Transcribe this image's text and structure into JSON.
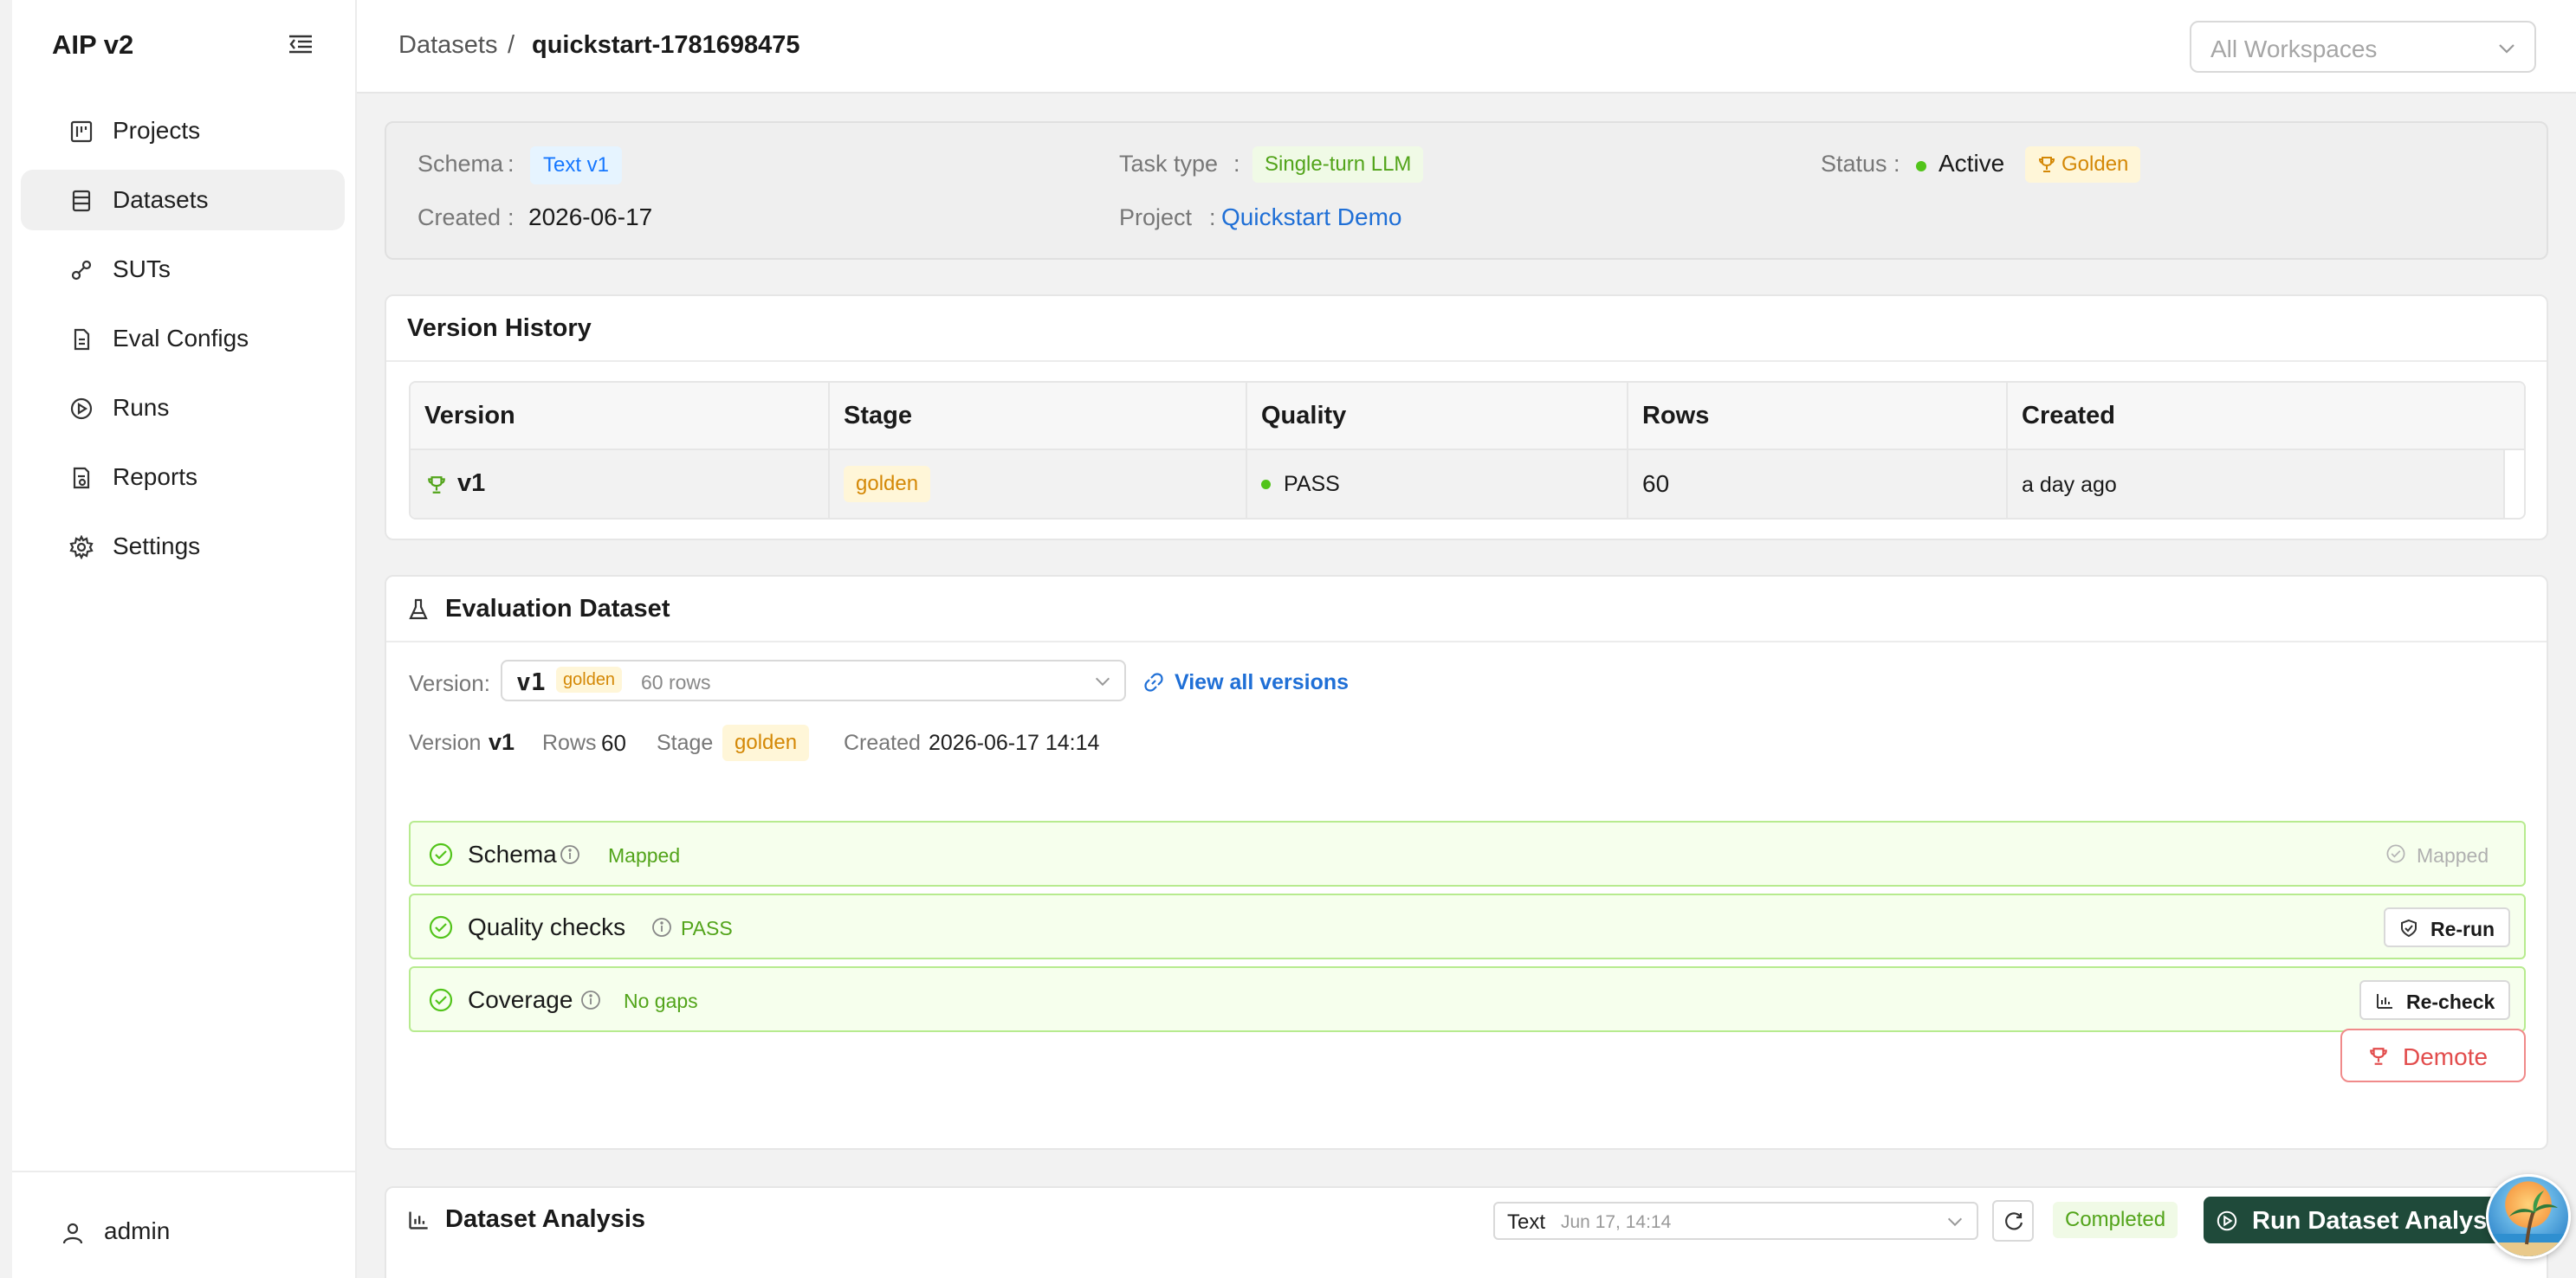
{
  "app": {
    "title": "AIP v2"
  },
  "sidebar": {
    "items": [
      {
        "label": "Projects",
        "icon": "projects-icon",
        "active": false
      },
      {
        "label": "Datasets",
        "icon": "datasets-icon",
        "active": true
      },
      {
        "label": "SUTs",
        "icon": "suts-icon",
        "active": false
      },
      {
        "label": "Eval Configs",
        "icon": "file-icon",
        "active": false
      },
      {
        "label": "Runs",
        "icon": "play-icon",
        "active": false
      },
      {
        "label": "Reports",
        "icon": "report-icon",
        "active": false
      },
      {
        "label": "Settings",
        "icon": "gear-icon",
        "active": false
      }
    ],
    "user": "admin"
  },
  "header": {
    "breadcrumb_root": "Datasets",
    "breadcrumb_sep": "/",
    "breadcrumb_current": "quickstart-1781698475",
    "workspace_placeholder": "All Workspaces"
  },
  "meta": {
    "schema_label": "Schema",
    "schema_value": "Text v1",
    "task_type_label": "Task type",
    "task_type_value": "Single-turn LLM",
    "status_label": "Status",
    "status_value": "Active",
    "golden_badge": "Golden",
    "created_label": "Created",
    "created_value": "2026-06-17",
    "project_label": "Project",
    "project_value": "Quickstart Demo",
    "colon": ":"
  },
  "version_history": {
    "title": "Version History",
    "columns": [
      "Version",
      "Stage",
      "Quality",
      "Rows",
      "Created"
    ],
    "rows": [
      {
        "version": "v1",
        "stage": "golden",
        "quality": "PASS",
        "rows": "60",
        "created": "a day ago"
      }
    ]
  },
  "eval_dataset": {
    "title": "Evaluation Dataset",
    "version_label": "Version:",
    "selected_version": "v1",
    "selected_stage": "golden",
    "selected_rows": "60 rows",
    "view_all": "View all versions",
    "summary": {
      "version_label": "Version",
      "version_value": "v1",
      "rows_label": "Rows",
      "rows_value": "60",
      "stage_label": "Stage",
      "stage_value": "golden",
      "created_label": "Created",
      "created_value": "2026-06-17 14:14"
    },
    "checks": [
      {
        "title": "Schema",
        "state": "Mapped",
        "action": "Mapped"
      },
      {
        "title": "Quality checks",
        "state": "PASS",
        "action": "Re-run"
      },
      {
        "title": "Coverage",
        "state": "No gaps",
        "action": "Re-check"
      }
    ],
    "demote": "Demote"
  },
  "analysis": {
    "title": "Dataset Analysis",
    "select_value": "Text",
    "select_time": "Jun 17, 14:14",
    "status": "Completed",
    "run_button": "Run Dataset Analysis"
  },
  "colors": {
    "accent": "#1f6fd6",
    "success": "#52c41a",
    "golden": "#d48806",
    "danger": "#e24c4c",
    "run_button": "#1f4a3a"
  }
}
